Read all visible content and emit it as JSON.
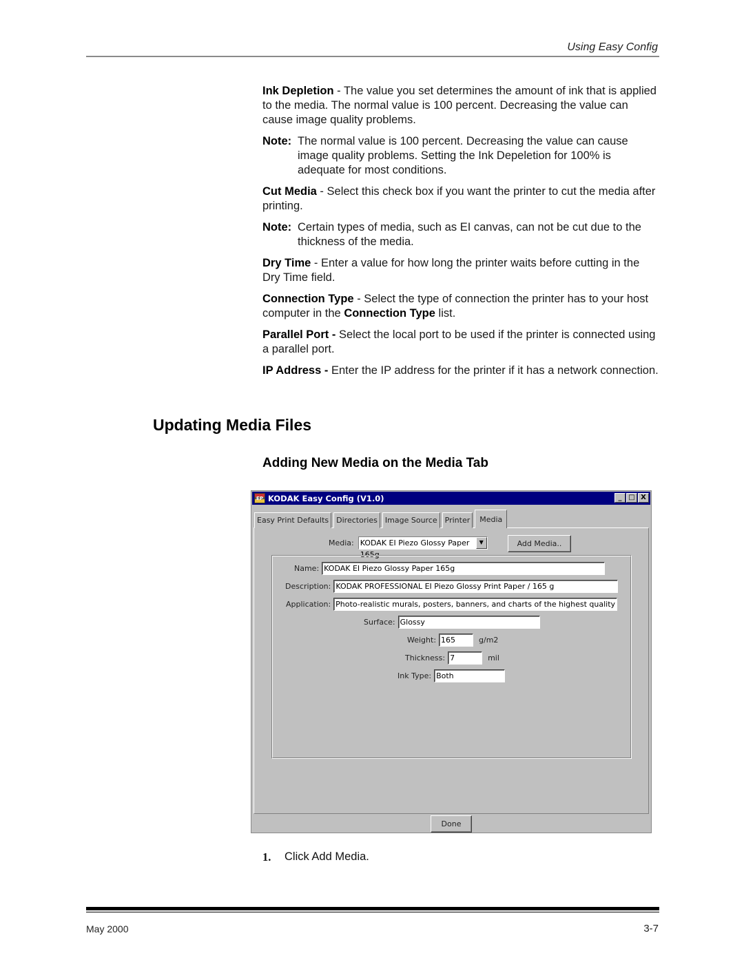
{
  "header": {
    "running_title": "Using Easy Config"
  },
  "body": {
    "paragraphs": [
      {
        "term": "Ink Depletion",
        "text": " - The value you set determines the amount of ink that is applied to the media. The normal value is 100 percent. Decreasing the value can cause image quality problems."
      },
      {
        "note_label": "Note:",
        "note_text": "The normal value is 100 percent. Decreasing the value can cause image quality problems. Setting the Ink Depeletion for 100% is adequate for most conditions."
      },
      {
        "term": "Cut Media",
        "text": " - Select this check box if you want the printer to cut the media after printing."
      },
      {
        "note_label": "Note:",
        "note_text": "Certain types of media, such as EI canvas, can not be cut due to the thickness of the media."
      },
      {
        "term": "Dry Time",
        "text": " - Enter a value for how long the printer waits before cutting in the Dry Time field."
      },
      {
        "term": "Connection Type",
        "text": " - Select the type of connection the printer has to your host computer in the ",
        "term2": "Connection Type",
        "text2": " list."
      },
      {
        "term": "Parallel Port -",
        "text": " Select the local port to be used if the printer is connected using a parallel port."
      },
      {
        "term": "IP Address -",
        "text": " Enter the IP address for the printer if it has a network connection."
      }
    ]
  },
  "section": {
    "heading": "Updating Media Files",
    "subheading": "Adding New Media on the Media Tab"
  },
  "window": {
    "title": "KODAK Easy Config (V1.0)",
    "icon_label": "EP",
    "controls": {
      "minimize": "_",
      "maximize": "□",
      "close": "X"
    },
    "tabs": [
      {
        "label": "Easy Print Defaults",
        "active": false
      },
      {
        "label": "Directories",
        "active": false
      },
      {
        "label": "Image Source",
        "active": false
      },
      {
        "label": "Printer",
        "active": false
      },
      {
        "label": "Media",
        "active": true
      }
    ],
    "media_label": "Media:",
    "media_selected": "KODAK EI Piezo Glossy Paper 165g",
    "add_media_button": "Add Media..",
    "fields": {
      "name": {
        "label": "Name:",
        "value": "KODAK EI Piezo Glossy Paper 165g"
      },
      "description": {
        "label": "Description:",
        "value": "KODAK PROFESSIONAL EI Piezo Glossy Print Paper / 165 g"
      },
      "application": {
        "label": "Application:",
        "value": "Photo-realistic murals, posters, banners, and charts of the highest quality"
      },
      "surface": {
        "label": "Surface:",
        "value": "Glossy"
      },
      "weight": {
        "label": "Weight:",
        "value": "165",
        "unit": "g/m2"
      },
      "thickness": {
        "label": "Thickness:",
        "value": "7",
        "unit": "mil"
      },
      "ink_type": {
        "label": "Ink Type:",
        "value": "Both"
      }
    },
    "done_button": "Done"
  },
  "step": {
    "number": "1.",
    "text": "Click Add Media."
  },
  "footer": {
    "date": "May 2000",
    "page": "3-7"
  }
}
